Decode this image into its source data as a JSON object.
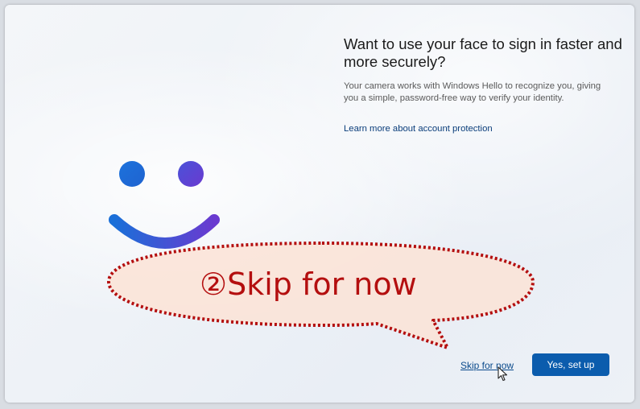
{
  "dialog": {
    "heading": "Want to use your face to sign in faster and more securely?",
    "description": "Your camera works with Windows Hello to recognize you, giving you a simple, password-free way to verify your identity.",
    "learn_more_link": "Learn more about account protection",
    "skip_link": "Skip for now",
    "primary_button": "Yes, set up"
  },
  "annotation": {
    "callout_text": "②Skip for now",
    "callout_color": "#b40f0f",
    "callout_fill": "#fbe3d6"
  },
  "icons": {
    "face": "windows-hello-face-icon",
    "cursor": "mouse-pointer-icon"
  },
  "colors": {
    "accent": "#0b5cad",
    "link": "#0a3d7a",
    "face_gradient_start": "#1a6fd8",
    "face_gradient_end": "#6a3ad0"
  }
}
